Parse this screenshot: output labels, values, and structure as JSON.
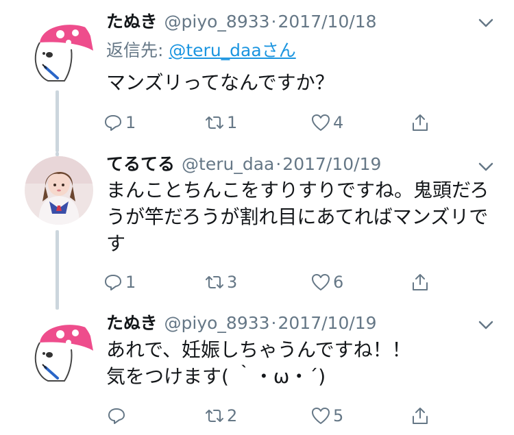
{
  "tweets": [
    {
      "name": "たぬき",
      "handle": "@piyo_8933",
      "date": "2017/10/18",
      "reply_prefix": "返信先: ",
      "reply_to": "@teru_daaさん",
      "text": "マンズリってなんですか？",
      "avatar_icon": "cartoon-character-avatar",
      "counts": {
        "reply": "1",
        "retweet": "1",
        "like": "4"
      }
    },
    {
      "name": "てるてる",
      "handle": "@teru_daa",
      "date": "2017/10/19",
      "text": "まんことちんこをすりすりですね。鬼頭だろうが竿だろうが割れ目にあてればマンズリです",
      "avatar_icon": "photo-avatar",
      "counts": {
        "reply": "1",
        "retweet": "3",
        "like": "6"
      }
    },
    {
      "name": "たぬき",
      "handle": "@piyo_8933",
      "date": "2017/10/19",
      "text": "あれで、妊娠しちゃうんですね！！\n気をつけます( ｀・ω・´)",
      "avatar_icon": "cartoon-character-avatar",
      "counts": {
        "reply": "",
        "retweet": "2",
        "like": "5"
      }
    }
  ],
  "separator": "·",
  "colors": {
    "text": "#14171a",
    "secondary": "#657786",
    "link": "#1b95e0",
    "thread_line": "#ccd6dd",
    "avatar_pink": "#ee4d8c"
  },
  "icons": {
    "reply": "reply-icon",
    "retweet": "retweet-icon",
    "like": "heart-icon",
    "share": "share-icon",
    "menu": "chevron-down-icon"
  }
}
